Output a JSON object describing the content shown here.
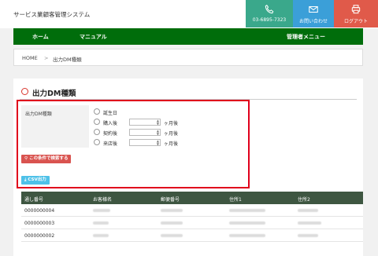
{
  "app": {
    "title": "サービス業顧客管理システム"
  },
  "header": {
    "phone": {
      "icon": "phone-icon",
      "label": "03-6895-7323"
    },
    "contact": {
      "icon": "mail-icon",
      "label": "お問い合わせ"
    },
    "logout": {
      "icon": "printer-icon",
      "label": "ログアウト"
    }
  },
  "nav": {
    "items": [
      "ホーム",
      "マニュアル",
      "管理者メニュー"
    ]
  },
  "breadcrumb": {
    "home": "HOME",
    "sep": ">",
    "current": "出力DM種類"
  },
  "page": {
    "title": "出力DM種類"
  },
  "form": {
    "label": "出力DM種類",
    "options": [
      {
        "label": "誕生日",
        "has_stepper": false
      },
      {
        "label": "購入後",
        "has_stepper": true,
        "unit": "ヶ月後"
      },
      {
        "label": "契約後",
        "has_stepper": true,
        "unit": "ヶ月後"
      },
      {
        "label": "来店後",
        "has_stepper": true,
        "unit": "ヶ月後"
      }
    ],
    "search_button": "この条件で検索する",
    "csv_button": "CSV出力"
  },
  "table": {
    "columns": [
      "通し番号",
      "お客様名",
      "郵便番号",
      "住所1",
      "住所2"
    ],
    "rows": [
      "0000000004",
      "0000000003",
      "0000000002"
    ]
  },
  "colors": {
    "nav": "#006d0b",
    "table_header": "#3e5641",
    "highlight": "#e0001b",
    "search_button": "#d9534f",
    "csv_button": "#4ec1e8"
  }
}
